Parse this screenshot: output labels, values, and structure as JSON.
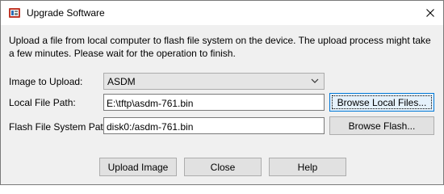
{
  "window": {
    "title": "Upgrade Software"
  },
  "description": "Upload a file from local computer to flash file system on the device. The upload process might take a few minutes. Please wait for the operation to finish.",
  "form": {
    "image_to_upload": {
      "label": "Image to Upload:",
      "selected": "ASDM"
    },
    "local_file_path": {
      "label": "Local File Path:",
      "value": "E:\\tftp\\asdm-761.bin"
    },
    "flash_file_system_path": {
      "label": "Flash File System Path:",
      "value": "disk0:/asdm-761.bin"
    }
  },
  "buttons": {
    "browse_local": "Browse Local Files...",
    "browse_flash": "Browse Flash...",
    "upload_image": "Upload Image",
    "close": "Close",
    "help": "Help"
  },
  "icons": {
    "app": "upgrade-software-icon",
    "close": "close-icon",
    "dropdown": "chevron-down-icon"
  },
  "colors": {
    "focus_border": "#0078d7",
    "dialog_background": "#f0f0f0",
    "button_face": "#e1e1e1"
  }
}
